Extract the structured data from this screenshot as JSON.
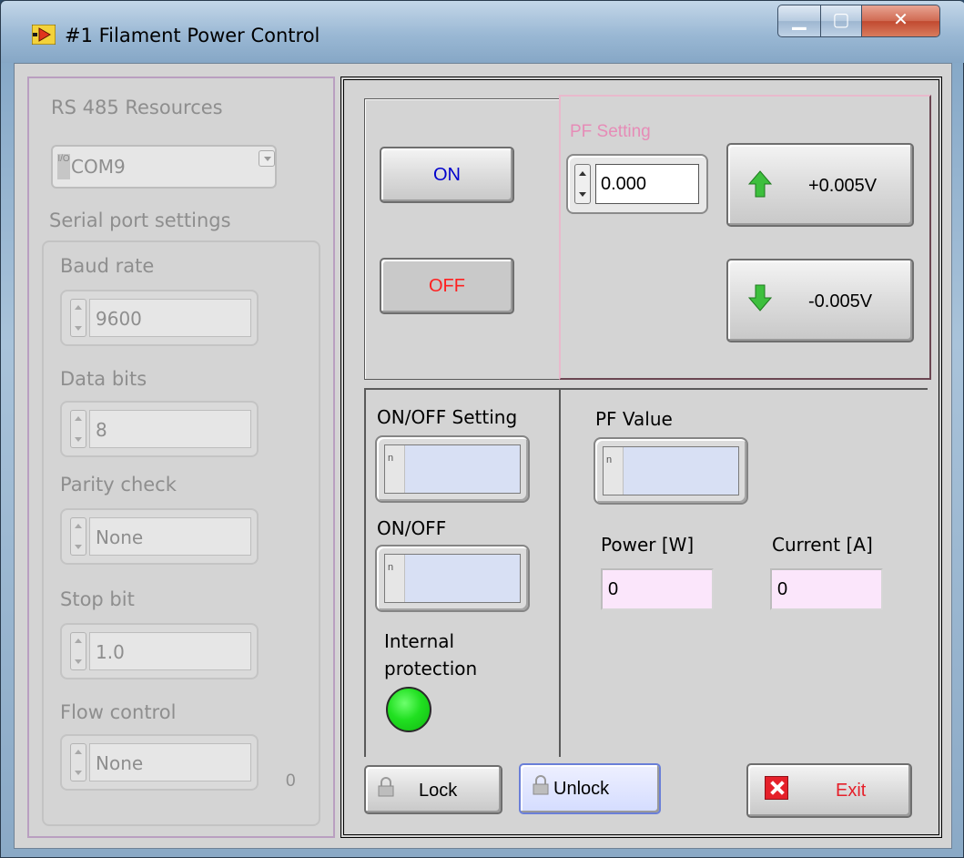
{
  "window": {
    "title": "#1 Filament Power Control"
  },
  "left": {
    "rs485_label": "RS 485 Resources",
    "resource_value": "COM9",
    "resource_io_tag": "I/O",
    "serial_label": "Serial port settings",
    "baud_label": "Baud rate",
    "baud_value": "9600",
    "data_bits_label": "Data bits",
    "data_bits_value": "8",
    "parity_label": "Parity check",
    "parity_value": "None",
    "stop_label": "Stop bit",
    "stop_value": "1.0",
    "flow_label": "Flow control",
    "flow_value": "None",
    "flow_index": "0"
  },
  "controls": {
    "on_label": "ON",
    "off_label": "OFF",
    "on_color": "#0000cc",
    "off_color": "#ff2020",
    "pf_setting_label": "PF Setting",
    "pf_setting_value": "0.000",
    "up_label": "+0.005V",
    "down_label": "-0.005V"
  },
  "status": {
    "onoff_setting_label": "ON/OFF Setting",
    "onoff_label": "ON/OFF",
    "pf_value_label": "PF Value",
    "indicator_tag": "n",
    "power_label": "Power [W]",
    "power_value": "0",
    "current_label": "Current [A]",
    "current_value": "0",
    "protection_label_1": "Internal",
    "protection_label_2": "protection"
  },
  "buttons": {
    "lock_label": "Lock",
    "unlock_label": "Unlock",
    "exit_label": "Exit",
    "exit_color": "#e5202a"
  }
}
